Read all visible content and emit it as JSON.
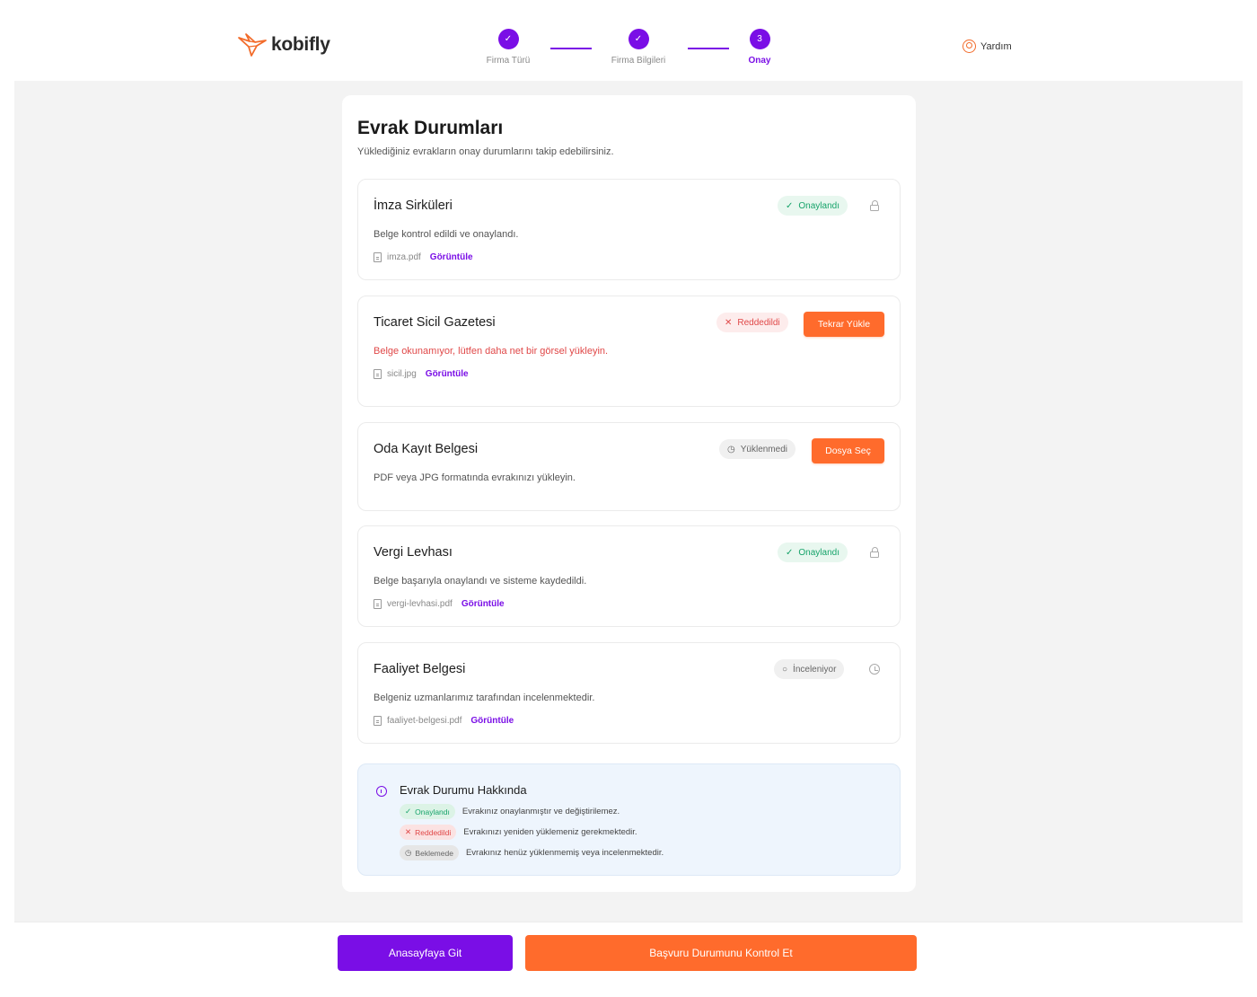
{
  "brand": {
    "name": "kobifly",
    "accent": "#7a0ee6",
    "orange": "#ff6b2c",
    "icon": "origami-bird-logo"
  },
  "stepper": {
    "steps": [
      {
        "label": "Firma Türü",
        "state": "done",
        "icon": "check-icon"
      },
      {
        "label": "Firma Bilgileri",
        "state": "done",
        "icon": "check-icon"
      },
      {
        "label": "Onay",
        "number": "3",
        "state": "active"
      }
    ]
  },
  "header": {
    "help_label": "Yardım",
    "help_icon": "user-circle-icon"
  },
  "page": {
    "title": "Evrak Durumları",
    "subtitle": "Yüklediğiniz evrakların onay durumlarını takip edebilirsiniz."
  },
  "documents": [
    {
      "title": "İmza Sirküleri",
      "status": "Onaylandı",
      "status_type": "approved",
      "description": "Belge kontrol edildi ve onaylandı.",
      "file": "imza.pdf",
      "view_label": "Görüntüle",
      "side": "lock-icon"
    },
    {
      "title": "Ticaret Sicil Gazetesi",
      "status": "Reddedildi",
      "status_type": "rejected",
      "description": "Belge okunamıyor, lütfen daha net bir görsel yükleyin.",
      "file": "sicil.jpg",
      "view_label": "Görüntüle",
      "action_label": "Tekrar Yükle"
    },
    {
      "title": "Oda Kayıt Belgesi",
      "status": "Yüklenmedi",
      "status_type": "not_uploaded",
      "description": "PDF veya JPG formatında evrakınızı yükleyin.",
      "action_label": "Dosya Seç"
    },
    {
      "title": "Vergi Levhası",
      "status": "Onaylandı",
      "status_type": "approved",
      "description": "Belge başarıyla onaylandı ve sisteme kaydedildi.",
      "file": "vergi-levhasi.pdf",
      "view_label": "Görüntüle",
      "side": "lock-icon"
    },
    {
      "title": "Faaliyet Belgesi",
      "status": "İnceleniyor",
      "status_type": "reviewing",
      "description": "Belgeniz uzmanlarımız tarafından incelenmektedir.",
      "file": "faaliyet-belgesi.pdf",
      "view_label": "Görüntüle",
      "side": "clock-icon"
    }
  ],
  "info": {
    "title": "Evrak Durumu Hakkında",
    "items": [
      {
        "badge": "Onaylandı",
        "type": "approved",
        "text": "Evrakınız onaylanmıştır ve değiştirilemez."
      },
      {
        "badge": "Reddedildi",
        "type": "rejected",
        "text": "Evrakınızı yeniden yüklemeniz gerekmektedir."
      },
      {
        "badge": "Beklemede",
        "type": "pending",
        "text": "Evrakınız henüz yüklenmemiş veya incelenmektedir."
      }
    ]
  },
  "footer": {
    "home_label": "Anasayfaya Git",
    "check_label": "Başvuru Durumunu Kontrol Et"
  }
}
